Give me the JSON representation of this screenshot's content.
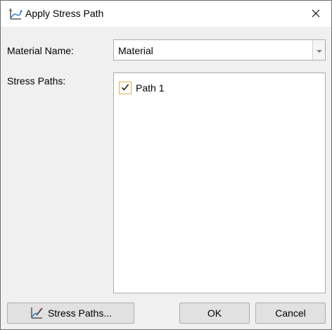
{
  "window": {
    "title": "Apply Stress Path",
    "app_icon": "stress-path-icon",
    "close_icon": "close-icon"
  },
  "form": {
    "material_label": "Material Name:",
    "material_value": "Material",
    "stress_paths_label": "Stress Paths:",
    "paths": [
      {
        "label": "Path 1",
        "checked": true
      }
    ]
  },
  "buttons": {
    "stress_paths": "Stress Paths...",
    "ok": "OK",
    "cancel": "Cancel"
  },
  "colors": {
    "checkbox_border": "#d9b64a",
    "accent": "#1f78c8"
  }
}
